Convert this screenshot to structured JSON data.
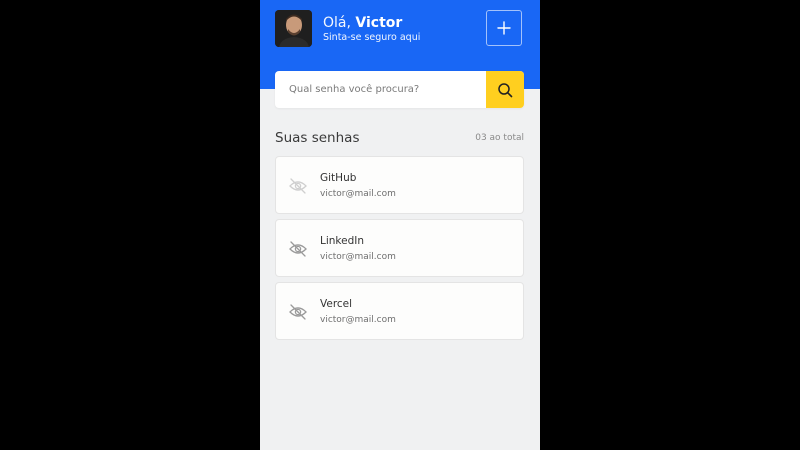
{
  "header": {
    "greeting_prefix": "Olá,",
    "user_name": "Victor",
    "subtitle": "Sinta-se seguro aqui",
    "add_icon": "plus-icon"
  },
  "search": {
    "placeholder": "Qual senha você procura?",
    "icon": "search-icon"
  },
  "section": {
    "title": "Suas senhas",
    "count": "03 ao total"
  },
  "passwords": [
    {
      "service": "GitHub",
      "email": "victor@mail.com",
      "icon": "eye-off-icon"
    },
    {
      "service": "LinkedIn",
      "email": "victor@mail.com",
      "icon": "eye-off-icon"
    },
    {
      "service": "Vercel",
      "email": "victor@mail.com",
      "icon": "eye-off-icon"
    }
  ],
  "colors": {
    "header_bg": "#1967f5",
    "search_button": "#ffcf1f",
    "page_bg": "#f0f1f2",
    "outer_bg": "#000000"
  }
}
